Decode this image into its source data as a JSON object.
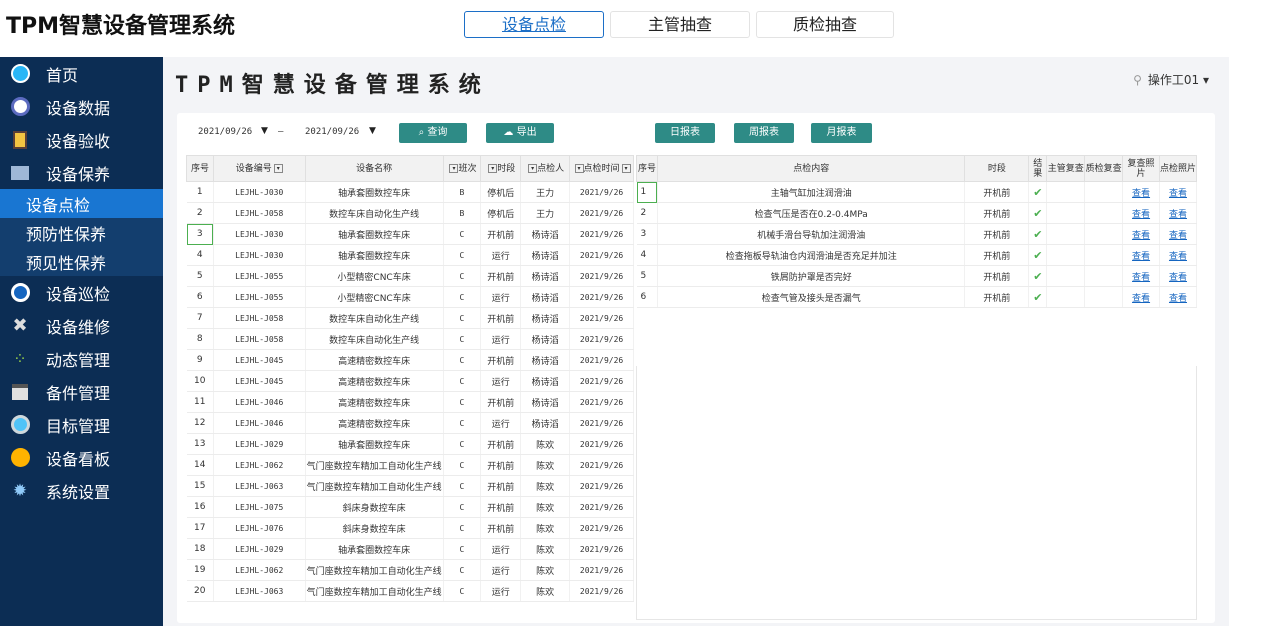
{
  "app_title": "TPM智慧设备管理系统",
  "top_tabs": [
    {
      "label": "设备点检",
      "active": true
    },
    {
      "label": "主管抽查",
      "active": false
    },
    {
      "label": "质检抽查",
      "active": false
    }
  ],
  "sidebar": {
    "items": [
      {
        "label": "首页",
        "icon": "home-icon"
      },
      {
        "label": "设备数据",
        "icon": "data-icon"
      },
      {
        "label": "设备验收",
        "icon": "acceptance-icon"
      },
      {
        "label": "设备保养",
        "icon": "maintenance-icon"
      }
    ],
    "subitems": [
      {
        "label": "设备点检",
        "active": true
      },
      {
        "label": "预防性保养",
        "active": false
      },
      {
        "label": "预见性保养",
        "active": false
      }
    ],
    "items2": [
      {
        "label": "设备巡检",
        "icon": "inspection-icon"
      },
      {
        "label": "设备维修",
        "icon": "repair-icon"
      },
      {
        "label": "动态管理",
        "icon": "share-icon"
      },
      {
        "label": "备件管理",
        "icon": "parts-icon"
      },
      {
        "label": "目标管理",
        "icon": "target-icon"
      },
      {
        "label": "设备看板",
        "icon": "board-icon"
      },
      {
        "label": "系统设置",
        "icon": "gear-icon"
      }
    ]
  },
  "main": {
    "title": "TPM智慧设备管理系统",
    "user": "操作工01",
    "user_caret": "▾"
  },
  "toolbar": {
    "date_from": "2021/09/26",
    "date_to": "2021/09/26",
    "dash": "–",
    "caret": "▼",
    "query": "查询",
    "export": "导出",
    "daily": "日报表",
    "weekly": "周报表",
    "monthly": "月报表"
  },
  "left_table": {
    "headers": [
      "序号",
      "设备编号",
      "设备名称",
      "班次",
      "时段",
      "点检人",
      "点检时间"
    ],
    "rows": [
      [
        "1",
        "LEJHL-J030",
        "轴承套圈数控车床",
        "B",
        "停机后",
        "王力",
        "2021/9/26"
      ],
      [
        "2",
        "LEJHL-J058",
        "数控车床自动化生产线",
        "B",
        "停机后",
        "王力",
        "2021/9/26"
      ],
      [
        "3",
        "LEJHL-J030",
        "轴承套圈数控车床",
        "C",
        "开机前",
        "杨诗滔",
        "2021/9/26"
      ],
      [
        "4",
        "LEJHL-J030",
        "轴承套圈数控车床",
        "C",
        "运行",
        "杨诗滔",
        "2021/9/26"
      ],
      [
        "5",
        "LEJHL-J055",
        "小型精密CNC车床",
        "C",
        "开机前",
        "杨诗滔",
        "2021/9/26"
      ],
      [
        "6",
        "LEJHL-J055",
        "小型精密CNC车床",
        "C",
        "运行",
        "杨诗滔",
        "2021/9/26"
      ],
      [
        "7",
        "LEJHL-J058",
        "数控车床自动化生产线",
        "C",
        "开机前",
        "杨诗滔",
        "2021/9/26"
      ],
      [
        "8",
        "LEJHL-J058",
        "数控车床自动化生产线",
        "C",
        "运行",
        "杨诗滔",
        "2021/9/26"
      ],
      [
        "9",
        "LEJHL-J045",
        "高速精密数控车床",
        "C",
        "开机前",
        "杨诗滔",
        "2021/9/26"
      ],
      [
        "10",
        "LEJHL-J045",
        "高速精密数控车床",
        "C",
        "运行",
        "杨诗滔",
        "2021/9/26"
      ],
      [
        "11",
        "LEJHL-J046",
        "高速精密数控车床",
        "C",
        "开机前",
        "杨诗滔",
        "2021/9/26"
      ],
      [
        "12",
        "LEJHL-J046",
        "高速精密数控车床",
        "C",
        "运行",
        "杨诗滔",
        "2021/9/26"
      ],
      [
        "13",
        "LEJHL-J029",
        "轴承套圈数控车床",
        "C",
        "开机前",
        "陈欢",
        "2021/9/26"
      ],
      [
        "14",
        "LEJHL-J062",
        "气门座数控车精加工自动化生产线",
        "C",
        "开机前",
        "陈欢",
        "2021/9/26"
      ],
      [
        "15",
        "LEJHL-J063",
        "气门座数控车精加工自动化生产线",
        "C",
        "开机前",
        "陈欢",
        "2021/9/26"
      ],
      [
        "16",
        "LEJHL-J075",
        "斜床身数控车床",
        "C",
        "开机前",
        "陈欢",
        "2021/9/26"
      ],
      [
        "17",
        "LEJHL-J076",
        "斜床身数控车床",
        "C",
        "开机前",
        "陈欢",
        "2021/9/26"
      ],
      [
        "18",
        "LEJHL-J029",
        "轴承套圈数控车床",
        "C",
        "运行",
        "陈欢",
        "2021/9/26"
      ],
      [
        "19",
        "LEJHL-J062",
        "气门座数控车精加工自动化生产线",
        "C",
        "运行",
        "陈欢",
        "2021/9/26"
      ],
      [
        "20",
        "LEJHL-J063",
        "气门座数控车精加工自动化生产线",
        "C",
        "运行",
        "陈欢",
        "2021/9/26"
      ]
    ]
  },
  "right_table": {
    "headers": [
      "序号",
      "点检内容",
      "时段",
      "结果",
      "主管复查",
      "质检复查",
      "复查照片",
      "点检照片"
    ],
    "rows": [
      {
        "no": "1",
        "content": "主轴气缸加注润滑油",
        "period": "开机前",
        "view1": "查看",
        "view2": "查看"
      },
      {
        "no": "2",
        "content": "检查气压是否在0.2-0.4MPa",
        "period": "开机前",
        "view1": "查看",
        "view2": "查看"
      },
      {
        "no": "3",
        "content": "机械手滑台导轨加注润滑油",
        "period": "开机前",
        "view1": "查看",
        "view2": "查看"
      },
      {
        "no": "4",
        "content": "检查拖板导轨油仓内润滑油是否充足并加注",
        "period": "开机前",
        "view1": "查看",
        "view2": "查看"
      },
      {
        "no": "5",
        "content": "铁屑防护罩是否完好",
        "period": "开机前",
        "view1": "查看",
        "view2": "查看"
      },
      {
        "no": "6",
        "content": "检查气管及接头是否漏气",
        "period": "开机前",
        "view1": "查看",
        "view2": "查看"
      }
    ],
    "check_mark": "✔"
  },
  "colors": {
    "sidebar_bg": "#0c2d54",
    "active_sub": "#1976d2",
    "button": "#2e8b86",
    "accent": "#1c6fc7"
  }
}
